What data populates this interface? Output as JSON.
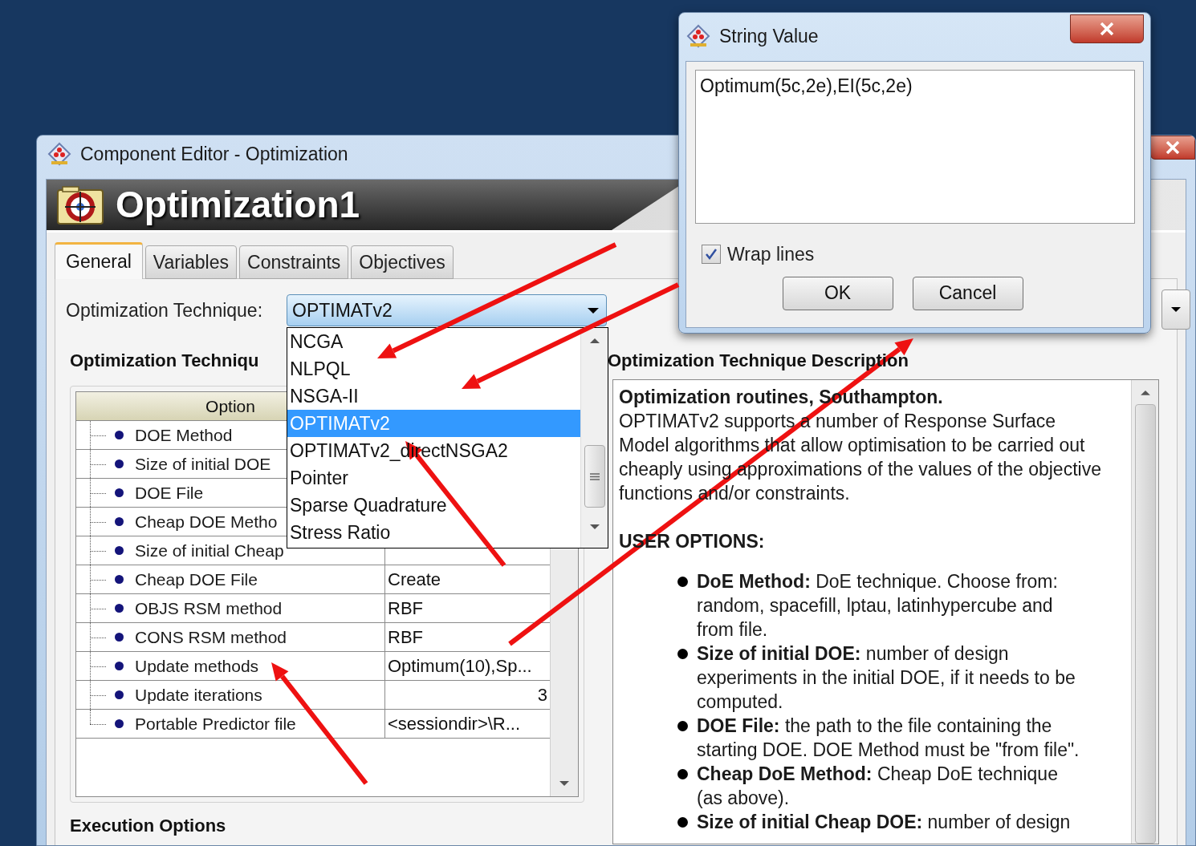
{
  "main_window": {
    "title": "Component Editor - Optimization",
    "header_title": "Optimization1",
    "tabs": [
      {
        "label": "General",
        "selected": true
      },
      {
        "label": "Variables",
        "selected": false
      },
      {
        "label": "Constraints",
        "selected": false
      },
      {
        "label": "Objectives",
        "selected": false
      }
    ],
    "technique_label": "Optimization Technique:",
    "technique_value": "OPTIMATv2",
    "options_panel": {
      "title": "Optimization Techniqu",
      "columns": [
        "Option"
      ],
      "rows": [
        {
          "option": "DOE Method"
        },
        {
          "option": "Size of initial DOE"
        },
        {
          "option": "DOE File"
        },
        {
          "option": "Cheap DOE Metho"
        },
        {
          "option": "Size of initial Cheap"
        },
        {
          "option": "Cheap DOE File",
          "value": "Create",
          "kind": "text"
        },
        {
          "option": "OBJS RSM method",
          "value": "RBF",
          "kind": "text"
        },
        {
          "option": "CONS RSM method",
          "value": "RBF",
          "kind": "text"
        },
        {
          "option": "Update methods",
          "value": "Optimum(10),Sp...",
          "kind": "text"
        },
        {
          "option": "Update iterations",
          "value": "3",
          "kind": "number"
        },
        {
          "option": "Portable Predictor file",
          "value": "<sessiondir>\\R...",
          "kind": "text"
        }
      ]
    },
    "description_panel": {
      "title": "Optimization Technique Description",
      "blocks": [
        {
          "kind": "title",
          "text": "Optimization routines, Southampton."
        },
        {
          "kind": "paragraph",
          "text": "OPTIMATv2 supports a number of Response Surface Model algorithms that allow optimisation to be carried out cheaply using approximations of the values of the objective functions and/or constraints."
        },
        {
          "kind": "section",
          "text": "USER OPTIONS:"
        },
        {
          "kind": "bullet",
          "text": "**DoE Method:** DoE technique. Choose from: random, spacefill, lptau, latinhypercube and from file."
        },
        {
          "kind": "bullet",
          "text": "**Size of initial DOE:** number of design experiments in the initial DOE, if it needs to be computed."
        },
        {
          "kind": "bullet",
          "text": "**DOE File:** the path to the file containing the starting DOE. DOE Method must be \"from file\"."
        },
        {
          "kind": "bullet",
          "text": "**Cheap DoE Method:** Cheap DoE technique (as above)."
        },
        {
          "kind": "bullet",
          "text": "**Size of initial Cheap DOE:** number of design"
        }
      ]
    },
    "execution_title": "Execution Options"
  },
  "dropdown": {
    "items": [
      {
        "label": "NCGA",
        "selected": false
      },
      {
        "label": "NLPQL",
        "selected": false
      },
      {
        "label": "NSGA-II",
        "selected": false
      },
      {
        "label": "OPTIMATv2",
        "selected": true
      },
      {
        "label": "OPTIMATv2_directNSGA2",
        "selected": false
      },
      {
        "label": "Pointer",
        "selected": false
      },
      {
        "label": "Sparse Quadrature",
        "selected": false
      },
      {
        "label": "Stress Ratio",
        "selected": false
      }
    ]
  },
  "string_dialog": {
    "title": "String Value",
    "value": "Optimum(5c,2e),EI(5c,2e)",
    "wrap_lines": {
      "label": "Wrap lines",
      "checked": true
    },
    "buttons": [
      "OK",
      "Cancel"
    ]
  }
}
